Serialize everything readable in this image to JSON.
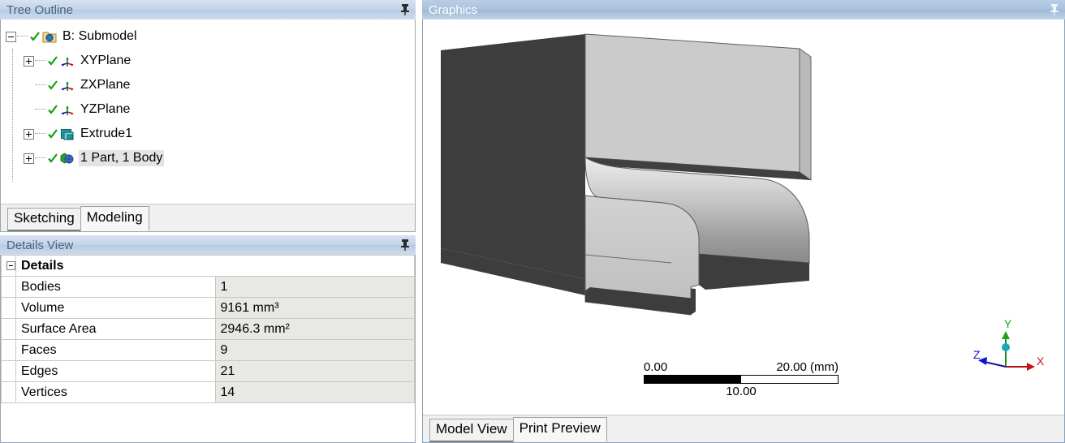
{
  "tree_panel": {
    "title": "Tree Outline",
    "pin_icon": "pushpin-icon",
    "items": [
      {
        "label": "B: Submodel",
        "depth": 0,
        "expander": "minus",
        "icon": "submodel-folder-icon",
        "check": "green-check-icon",
        "selected": false
      },
      {
        "label": "XYPlane",
        "depth": 1,
        "expander": "plus",
        "icon": "plane-axes-icon",
        "check": "green-check-icon",
        "selected": false
      },
      {
        "label": "ZXPlane",
        "depth": 1,
        "expander": "none",
        "icon": "plane-axes-icon",
        "check": "green-check-icon",
        "selected": false
      },
      {
        "label": "YZPlane",
        "depth": 1,
        "expander": "none",
        "icon": "plane-axes-icon",
        "check": "green-check-icon",
        "selected": false
      },
      {
        "label": "Extrude1",
        "depth": 1,
        "expander": "plus",
        "icon": "extrude-icon",
        "check": "green-check-icon",
        "selected": false
      },
      {
        "label": "1 Part, 1 Body",
        "depth": 1,
        "expander": "plus",
        "icon": "body-cube-icon",
        "check": "green-check-icon",
        "selected": true
      }
    ],
    "tabs": [
      {
        "label": "Sketching",
        "active": false
      },
      {
        "label": "Modeling",
        "active": true
      }
    ]
  },
  "details_panel": {
    "title": "Details View",
    "pin_icon": "pushpin-icon",
    "group_label": "Details",
    "rows": [
      {
        "key": "Bodies",
        "value": "1"
      },
      {
        "key": "Volume",
        "value": "9161 mm³"
      },
      {
        "key": "Surface Area",
        "value": "2946.3 mm²"
      },
      {
        "key": "Faces",
        "value": "9"
      },
      {
        "key": "Edges",
        "value": "21"
      },
      {
        "key": "Vertices",
        "value": "14"
      }
    ]
  },
  "graphics_panel": {
    "title": "Graphics",
    "pin_icon": "pushpin-icon",
    "active": true,
    "scale_bar": {
      "min_label": "0.00",
      "mid_label": "10.00",
      "max_label": "20.00 (mm)"
    },
    "triad": {
      "x_label": "X",
      "y_label": "Y",
      "z_label": "Z",
      "x_color": "#d00000",
      "y_color": "#00a000",
      "z_color": "#1010d0"
    },
    "model": {
      "name": "filleted-l-bracket",
      "face_dark": "#3d3d3d",
      "face_light": "#cfcfcf",
      "face_mid": "#8f8f8f",
      "edge_color": "#606060"
    },
    "tabs": [
      {
        "label": "Model View",
        "active": false
      },
      {
        "label": "Print Preview",
        "active": true
      }
    ]
  }
}
